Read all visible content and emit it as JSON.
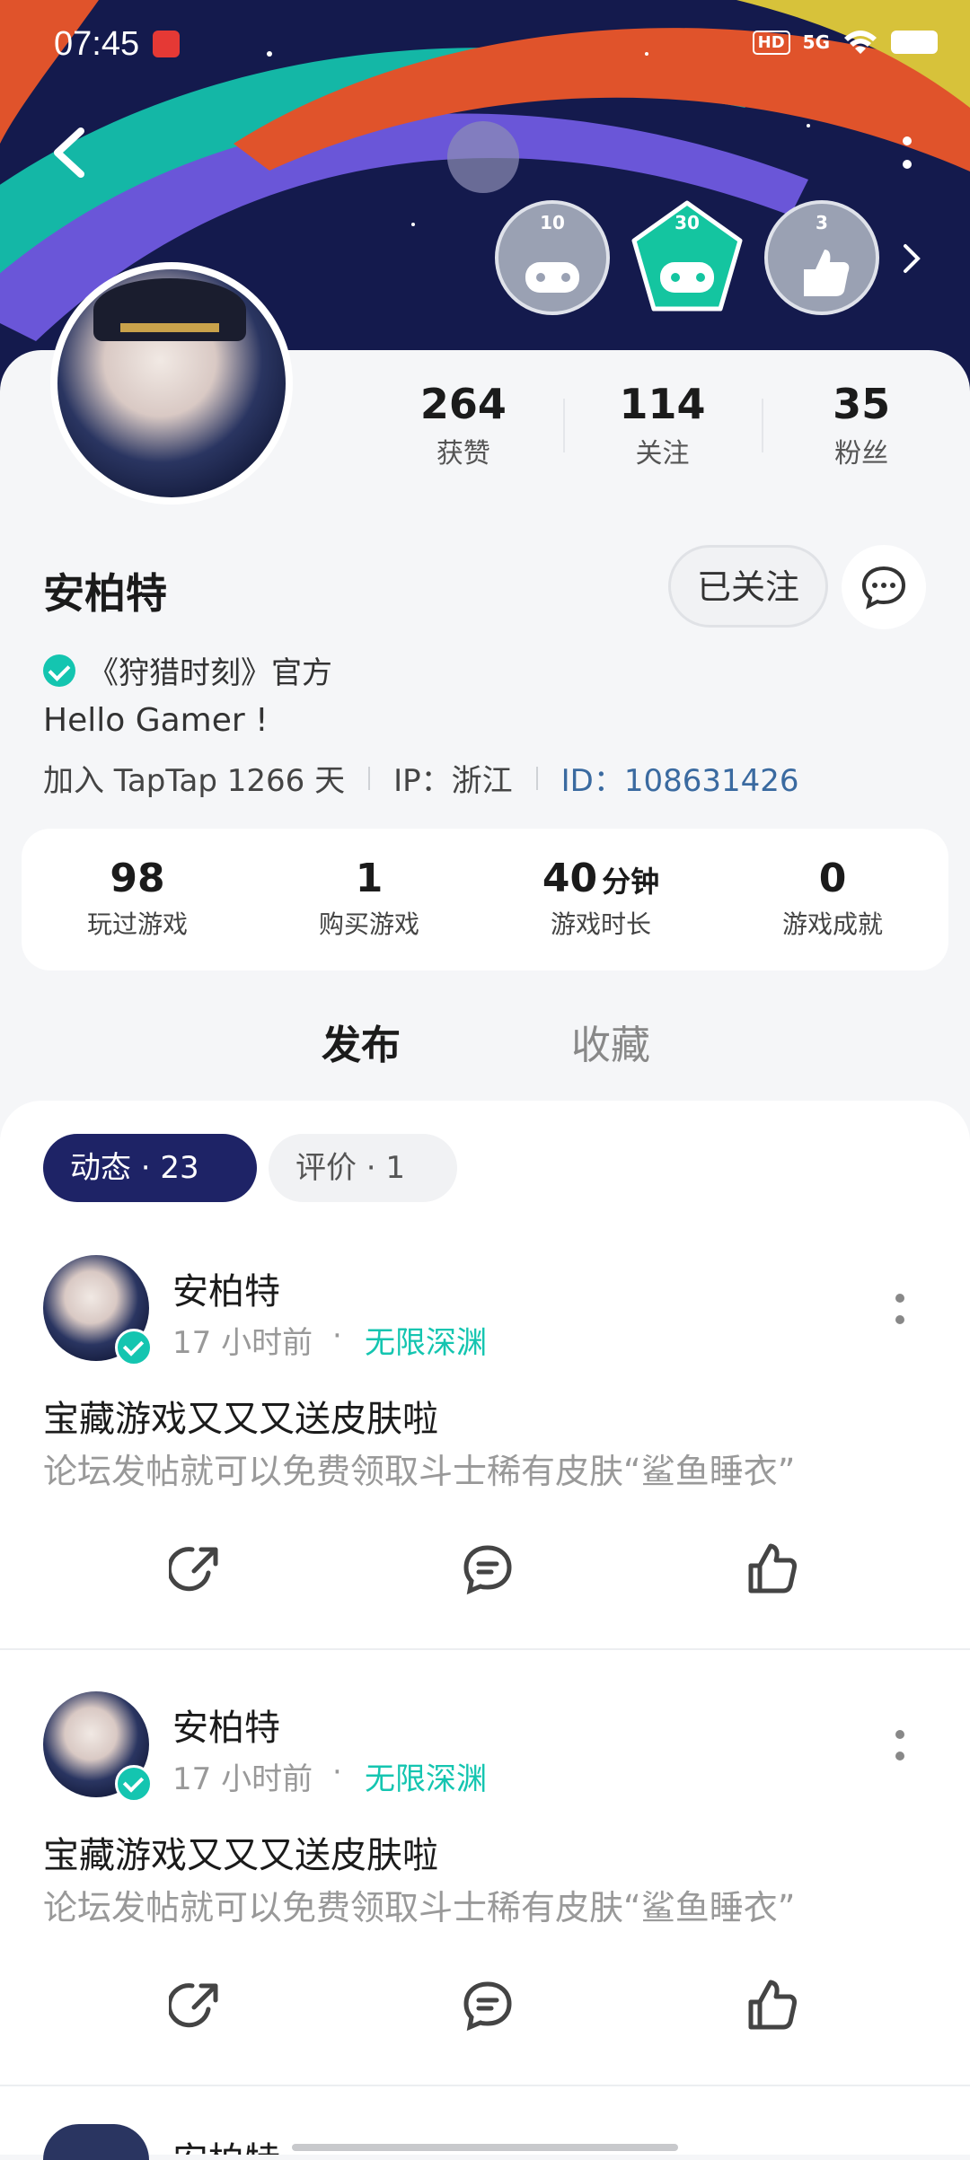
{
  "status_bar": {
    "time": "07:45",
    "hd": "HD",
    "signal": "5G"
  },
  "badges": [
    {
      "num": "10",
      "color": "#9aa1b3"
    },
    {
      "num": "30",
      "color": "#14c5a0"
    },
    {
      "num": "3",
      "color": "#9aa1b3"
    }
  ],
  "profile": {
    "stats": [
      {
        "value": "264",
        "label": "获赞"
      },
      {
        "value": "114",
        "label": "关注"
      },
      {
        "value": "35",
        "label": "粉丝"
      }
    ],
    "name": "安柏特",
    "follow_label": "已关注",
    "verified_text": "《狩猎时刻》官方",
    "bio": "Hello Gamer !",
    "joined": "加入 TapTap 1266 天",
    "ip": "IP：浙江",
    "id": "ID：108631426"
  },
  "game_stats": [
    {
      "value": "98",
      "unit": "",
      "label": "玩过游戏"
    },
    {
      "value": "1",
      "unit": "",
      "label": "购买游戏"
    },
    {
      "value": "40",
      "unit": "分钟",
      "label": "游戏时长"
    },
    {
      "value": "0",
      "unit": "",
      "label": "游戏成就"
    }
  ],
  "tabs": {
    "publish": "发布",
    "favorite": "收藏"
  },
  "chips": {
    "dynamic": "动态 · 23",
    "review": "评价 · 1"
  },
  "posts": [
    {
      "author": "安柏特",
      "time": "17 小时前",
      "dot": "·",
      "game": "无限深渊",
      "title": "宝藏游戏又又又送皮肤啦",
      "body": "论坛发帖就可以免费领取斗士稀有皮肤“鲨鱼睡衣”"
    },
    {
      "author": "安柏特",
      "time": "17 小时前",
      "dot": "·",
      "game": "无限深渊",
      "title": "宝藏游戏又又又送皮肤啦",
      "body": "论坛发帖就可以免费领取斗士稀有皮肤“鲨鱼睡衣”"
    }
  ],
  "peek_author": "安柏特",
  "colors": {
    "accent": "#14c5b0",
    "banner": "#141a4d",
    "chip_active": "#1e2366",
    "id_link": "#3a6aa0"
  }
}
